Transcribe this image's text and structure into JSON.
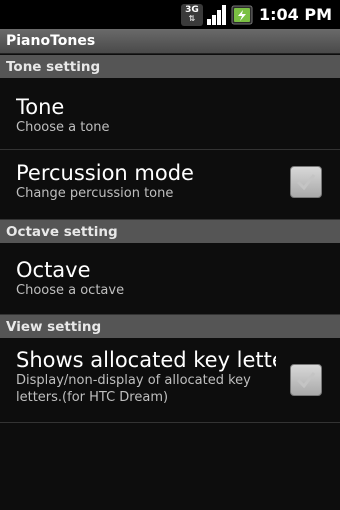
{
  "status_bar": {
    "network_label": "3G",
    "time": "1:04 PM",
    "icons": [
      "network-3g-icon",
      "signal-icon",
      "battery-charging-icon"
    ]
  },
  "app": {
    "title": "PianoTones"
  },
  "sections": {
    "tone": {
      "header": "Tone setting",
      "tone": {
        "title": "Tone",
        "summary": "Choose a tone"
      },
      "percussion": {
        "title": "Percussion mode",
        "summary": "Change percussion tone",
        "checked": false
      }
    },
    "octave": {
      "header": "Octave setting",
      "octave": {
        "title": "Octave",
        "summary": "Choose a octave"
      }
    },
    "view": {
      "header": "View setting",
      "letters": {
        "title": "Shows allocated key letters",
        "summary": "Display/non-display of allocated key letters.(for HTC Dream)",
        "checked": false
      }
    }
  },
  "colors": {
    "section_header_bg": "#555555",
    "title_bar_bg": "#5a5a5a",
    "background": "#0d0d0d"
  }
}
